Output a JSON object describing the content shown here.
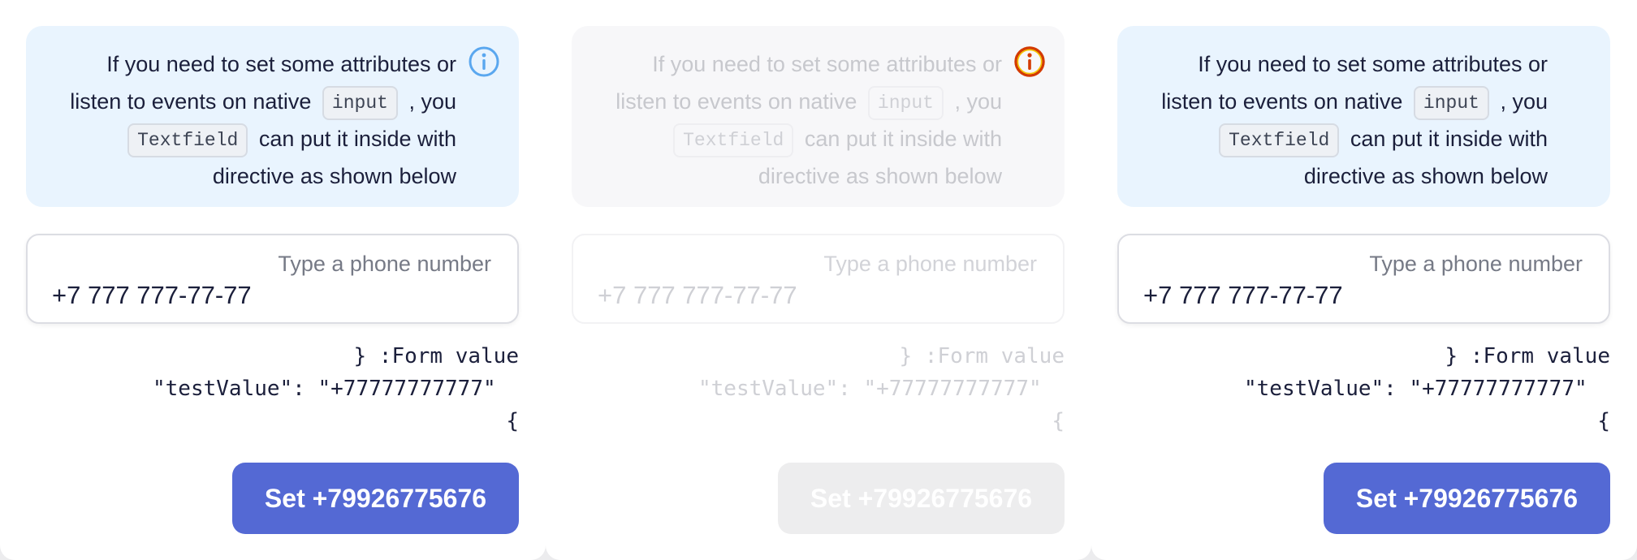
{
  "panels": [
    {
      "state": "normal",
      "notice": {
        "line1": "If you need to set some attributes or",
        "line2a": "listen to events on native",
        "chip1": "input",
        "line2b": ", you",
        "line3a": "can put it inside with",
        "chip2": "Textfield",
        "line4": "directive as shown below",
        "icon": "info-icon"
      },
      "phone": {
        "label": "Type a phone number",
        "value": "+7 777 777-77-77"
      },
      "form_value": {
        "line1": "} :Form value",
        "line2": "\"testValue\": \"+77777777777\"",
        "line3": "{"
      },
      "button": {
        "label": "Set +79926775676"
      }
    },
    {
      "state": "disabled",
      "notice": {
        "line1": "If you need to set some attributes or",
        "line2a": "listen to events on native",
        "chip1": "input",
        "line2b": ", you",
        "line3a": "can put it inside with",
        "chip2": "Textfield",
        "line4": "directive as shown below",
        "icon": "info-icon"
      },
      "phone": {
        "label": "Type a phone number",
        "value": "+7 777 777-77-77"
      },
      "form_value": {
        "line1": "} :Form value",
        "line2": "\"testValue\": \"+77777777777\"",
        "line3": "{"
      },
      "button": {
        "label": "Set +79926775676"
      }
    },
    {
      "state": "normal",
      "notice": {
        "line1": "If you need to set some attributes or",
        "line2a": "listen to events on native",
        "chip1": "input",
        "line2b": ", you",
        "line3a": "can put it inside with",
        "chip2": "Textfield",
        "line4": "directive as shown below",
        "icon": "none"
      },
      "phone": {
        "label": "Type a phone number",
        "value": "+7 777 777-77-77"
      },
      "form_value": {
        "line1": "} :Form value",
        "line2": "\"testValue\": \"+77777777777\"",
        "line3": "{"
      },
      "button": {
        "label": "Set +79926775676"
      }
    }
  ],
  "colors": {
    "accent": "#5469d4",
    "notice_bg": "#e9f4fe",
    "info_icon_normal": "#5aa7ef",
    "info_icon_disabled": "#d33a00",
    "text": "#1b1f3b"
  }
}
